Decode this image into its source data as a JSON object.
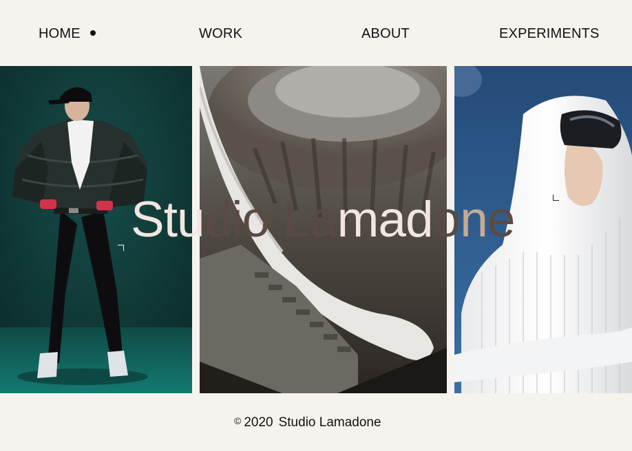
{
  "nav": {
    "home": "HOME",
    "work": "WORK",
    "about": "ABOUT",
    "experiments": "EXPERIMENTS",
    "active_indicator": "dot-icon"
  },
  "hero": {
    "title": "Studio Lamadone"
  },
  "panels": [
    {
      "subject": "model-in-black-puffer-jacket",
      "bg": "#0f3a38"
    },
    {
      "subject": "concrete-spiral-staircase",
      "bg": "#5f5b55"
    },
    {
      "subject": "model-in-white-ski-hood-goggles",
      "bg": "#2f5a8a"
    }
  ],
  "footer": {
    "copyright_symbol": "©",
    "year": "2020",
    "studio": "Studio Lamadone"
  },
  "colors": {
    "background": "#f6f3ef",
    "text": "#111111",
    "title_light": "#f1e6e2",
    "title_dark": "#5a4a44",
    "title_tan": "#c9a98f"
  }
}
